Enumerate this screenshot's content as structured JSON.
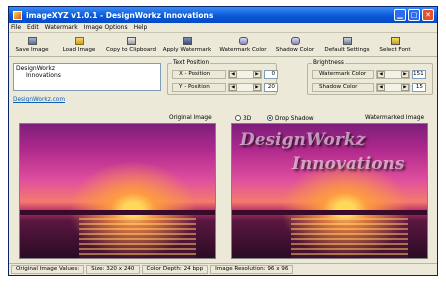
{
  "window": {
    "title": "imageXYZ v1.0.1 - DesignWorkz Innovations"
  },
  "menu": [
    "File",
    "Edit",
    "Watermark",
    "Image Options",
    "Help"
  ],
  "toolbar": {
    "save": "Save Image",
    "load": "Load Image",
    "copy": "Copy to Clipboard",
    "apply": "Apply Watermark",
    "wmcolor": "Watermark Color",
    "shadowcolor": "Shadow Color",
    "default": "Default Settings",
    "font": "Select Font"
  },
  "filebox": {
    "line1": "DesignWorkz",
    "line2": "Innovations"
  },
  "link": "DesignWorkz.com",
  "text_position": {
    "legend": "Text Position",
    "x_label": "X - Position",
    "x_value": "0",
    "y_label": "Y - Position",
    "y_value": "20"
  },
  "brightness": {
    "legend": "Brightness",
    "wm_label": "Watermark Color",
    "wm_value": "151",
    "shadow_label": "Shadow Color",
    "shadow_value": "15"
  },
  "captions": {
    "original": "Original Image",
    "opt_3d": "3D",
    "opt_drop": "Drop Shadow",
    "watermarked": "Watermarked Image"
  },
  "watermark": {
    "line1": "DesignWorkz",
    "line2": "Innovations"
  },
  "status": {
    "values": "Original Image Values:",
    "size": "Size: 320 x 240",
    "depth": "Color Depth: 24 bpp",
    "resolution": "Image Resolution: 96 x 96"
  },
  "icons": {
    "save": "save-icon",
    "load": "folder-icon",
    "copy": "clipboard-icon",
    "apply": "watermark-icon",
    "wmcolor": "palette-icon",
    "shadowcolor": "palette-icon",
    "default": "settings-icon",
    "font": "font-icon"
  }
}
